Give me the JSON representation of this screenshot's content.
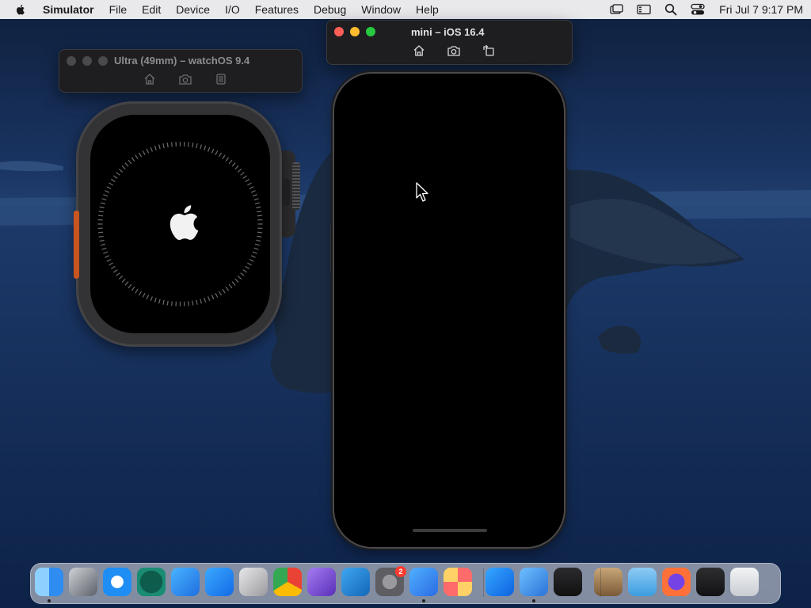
{
  "menubar": {
    "app_name": "Simulator",
    "items": [
      "File",
      "Edit",
      "Device",
      "I/O",
      "Features",
      "Debug",
      "Window",
      "Help"
    ],
    "clock": "Fri Jul 7  9:17 PM",
    "status_icons": [
      "mirror-icon",
      "window-icon",
      "search-icon",
      "control-center-icon"
    ]
  },
  "watch_window": {
    "title": "Ultra (49mm) – watchOS 9.4",
    "tools": [
      "home-icon",
      "screenshot-icon",
      "rotate-icon"
    ]
  },
  "phone_window": {
    "title": "mini – iOS 16.4",
    "tools": [
      "home-icon",
      "screenshot-icon",
      "rotate-icon"
    ]
  },
  "traffic_light_colors": {
    "close": "#ff5f57",
    "minimize": "#febc2e",
    "zoom": "#28c840",
    "inactive": "#4a4a4d"
  },
  "dock": {
    "items": [
      {
        "name": "finder-icon",
        "running": true
      },
      {
        "name": "screenshot-grid-icon",
        "running": false
      },
      {
        "name": "safari-icon",
        "running": false
      },
      {
        "name": "time-machine-icon",
        "running": false
      },
      {
        "name": "testflight-icon",
        "running": false
      },
      {
        "name": "app-store-connect-icon",
        "running": false
      },
      {
        "name": "automator-icon",
        "running": false
      },
      {
        "name": "chrome-icon",
        "running": false
      },
      {
        "name": "visual-studio-icon",
        "running": false
      },
      {
        "name": "vscode-icon",
        "running": false
      },
      {
        "name": "system-settings-icon",
        "running": false
      },
      {
        "name": "xcode-instruments-icon",
        "running": true
      },
      {
        "name": "launchpad-icon",
        "running": false
      },
      {
        "name": "app-store-icon",
        "running": false
      },
      {
        "name": "xcode-icon",
        "running": true
      },
      {
        "name": "terminal-activity-icon",
        "running": false
      },
      {
        "name": "archive-utility-icon",
        "running": false
      },
      {
        "name": "folder-icon",
        "running": false
      },
      {
        "name": "firefox-icon",
        "running": false
      },
      {
        "name": "activity-monitor-icon",
        "running": false
      },
      {
        "name": "trash-icon",
        "running": false
      }
    ],
    "settings_badge": "2"
  }
}
